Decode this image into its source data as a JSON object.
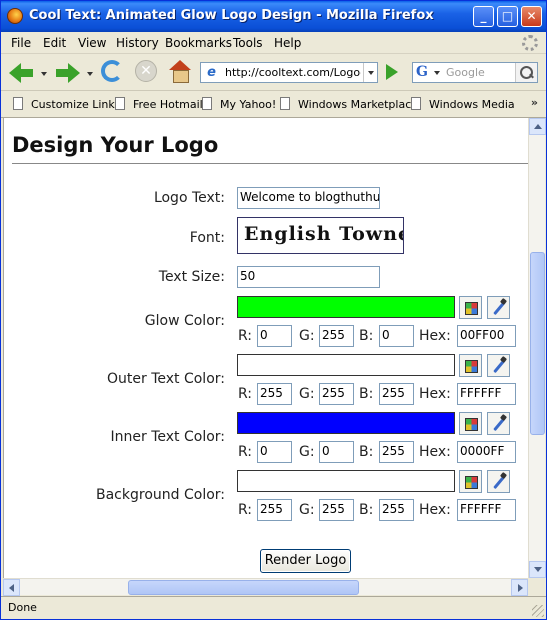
{
  "window": {
    "title": "Cool Text: Animated Glow Logo Design - Mozilla Firefox",
    "minimize_glyph": "_",
    "maximize_glyph": "□",
    "close_glyph": "✕"
  },
  "menu": [
    "File",
    "Edit",
    "View",
    "History",
    "Bookmarks",
    "Tools",
    "Help"
  ],
  "nav": {
    "url": "http://cooltext.com/Logo-D",
    "search_placeholder": "Google",
    "search_engine_glyph": "G",
    "favicon_glyph": "e",
    "stop_glyph": "✕"
  },
  "bookmarks": [
    "Customize Links",
    "Free Hotmail",
    "My Yahoo!",
    "Windows Marketplace",
    "Windows Media"
  ],
  "bookmarks_more": "»",
  "page": {
    "title": "Design Your Logo",
    "logo_text_label": "Logo Text:",
    "logo_text_value": "Welcome to blogthuthuat",
    "font_label": "Font:",
    "font_preview": "English Towne",
    "text_size_label": "Text Size:",
    "text_size_value": "50",
    "colors": [
      {
        "label": "Glow Color:",
        "swatch": "#00FF00",
        "r": "0",
        "g": "255",
        "b": "0",
        "hex": "00FF00"
      },
      {
        "label": "Outer Text Color:",
        "swatch": "#FFFFFF",
        "r": "255",
        "g": "255",
        "b": "255",
        "hex": "FFFFFF"
      },
      {
        "label": "Inner Text Color:",
        "swatch": "#0000FF",
        "r": "0",
        "g": "0",
        "b": "255",
        "hex": "0000FF"
      },
      {
        "label": "Background Color:",
        "swatch": "#FFFFFF",
        "r": "255",
        "g": "255",
        "b": "255",
        "hex": "FFFFFF"
      }
    ],
    "channel_labels": {
      "r": "R:",
      "g": "G:",
      "b": "B:",
      "hex": "Hex:"
    },
    "render_button": "Render Logo"
  },
  "status": "Done"
}
